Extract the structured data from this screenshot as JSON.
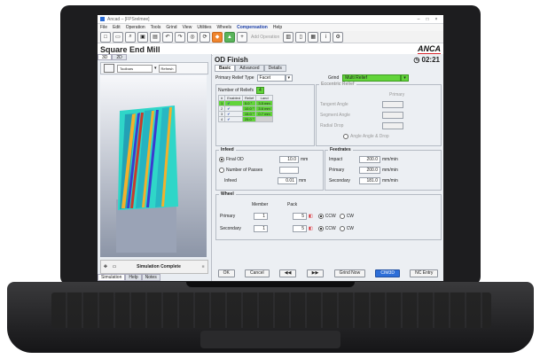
{
  "window": {
    "title": "Ancad – [FPSrelmee]"
  },
  "menu": [
    "File",
    "Edit",
    "Operation",
    "Tools",
    "Grind",
    "View",
    "Utilities",
    "Wheels",
    "Compensation",
    "Help"
  ],
  "toolbar": {
    "add_operation": "Add Operation"
  },
  "page_title": "Square End Mill",
  "logo": "ANCA",
  "left_panel": {
    "tabs": [
      "3D",
      "2D"
    ],
    "view_select": "Toolbars",
    "refresh": "Refresh",
    "status": "Simulation Complete",
    "bottom_tabs": [
      "Simulation",
      "Help",
      "Notes"
    ]
  },
  "op": {
    "title": "OD Finish",
    "time": "02:21",
    "tabs": [
      "Basic",
      "Advanced",
      "Details"
    ],
    "primary_relief_type_label": "Primary Relief Type",
    "primary_relief_type": "Facet",
    "grind_label": "Grind",
    "grind_value": "Multi Relief",
    "number_of_reliefs_label": "Number of Reliefs",
    "number_of_reliefs": "4",
    "table_headers": [
      "#",
      "Enabled",
      "Relief",
      "Land"
    ],
    "reliefs": [
      {
        "n": "1",
        "relief": "5.0 °",
        "land": "3.5 mm"
      },
      {
        "n": "2",
        "relief": "10.0 °",
        "land": "3.6 mm"
      },
      {
        "n": "3",
        "relief": "15.0 °",
        "land": "0.7 mm"
      },
      {
        "n": "4",
        "relief": "25.0 °",
        "land": ""
      }
    ],
    "eccentric": {
      "title": "Eccentric Relief",
      "primary": "Primary",
      "tangent_angle": "Tangent Angle",
      "segment_angle": "Segment Angle",
      "radial_drop": "Radial Drop",
      "angle_options": "Angle  Angle & Drop"
    },
    "infeed": {
      "title": "Infeed",
      "final_od": "Final OD",
      "final_od_value": "10.0",
      "unit_mm": "mm",
      "number_of_passes": "Number of Passes",
      "infeed_label": "Infeed",
      "infeed_value": "0.01"
    },
    "feedrates": {
      "title": "Feedrates",
      "impact": "Impact",
      "impact_value": "200.0",
      "primary": "Primary",
      "primary_value": "200.0",
      "secondary": "Secondary",
      "secondary_value": "181.0",
      "unit": "mm/min"
    },
    "wheel": {
      "title": "Wheel",
      "member": "Member",
      "pack": "Pack",
      "primary": "Primary",
      "secondary": "Secondary",
      "primary_member": "1",
      "secondary_member": "1",
      "primary_pack": "5",
      "secondary_pack": "5",
      "ccw": "CCW",
      "cw": "CW"
    },
    "buttons": [
      "OK",
      "Cancel",
      "◀◀",
      "▶▶",
      "Grind Now",
      "CIM3D",
      "NC Entry"
    ]
  }
}
